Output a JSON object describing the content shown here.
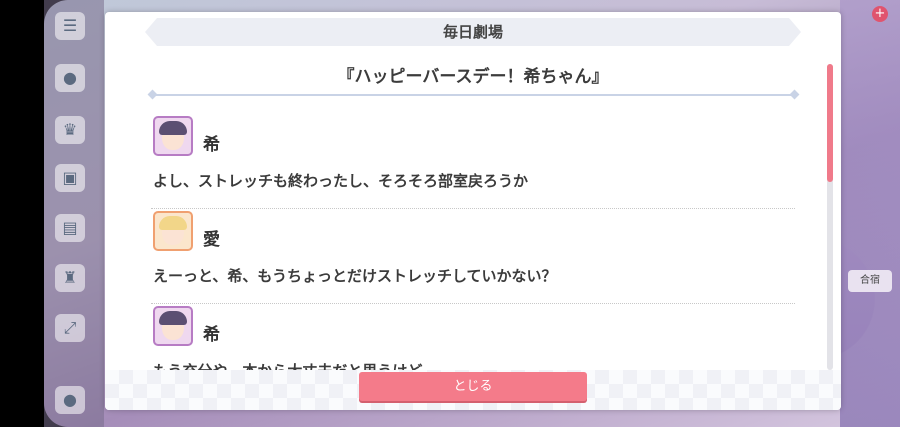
{
  "window": {
    "header": "毎日劇場",
    "story_title": "『ハッピーバースデー！希ちゃん』"
  },
  "lines": [
    {
      "speaker": "希",
      "avatar": "nozomi",
      "text": "よし、ストレッチも終わったし、そろそろ部室戻ろうか"
    },
    {
      "speaker": "愛",
      "avatar": "ai",
      "text": "えーっと、希、もうちょっとだけストレッチしていかない？"
    },
    {
      "speaker": "希",
      "avatar": "nozomi",
      "text": "もう充分や。本から大丈夫だと思うけど"
    }
  ],
  "buttons": {
    "close": "とじる"
  },
  "background": {
    "left_rail_icons": [
      "menu-icon",
      "chat-icon",
      "crown-icon",
      "gift-icon",
      "board-icon",
      "trophy-icon",
      "expand-icon",
      "user-icon"
    ],
    "right_chips": [
      "合宿"
    ]
  },
  "colors": {
    "accent": "#f47b8a",
    "scroll_thumb": "#f07a8a",
    "nozomi_frame": "#b77cc4",
    "ai_frame": "#f0a070"
  }
}
